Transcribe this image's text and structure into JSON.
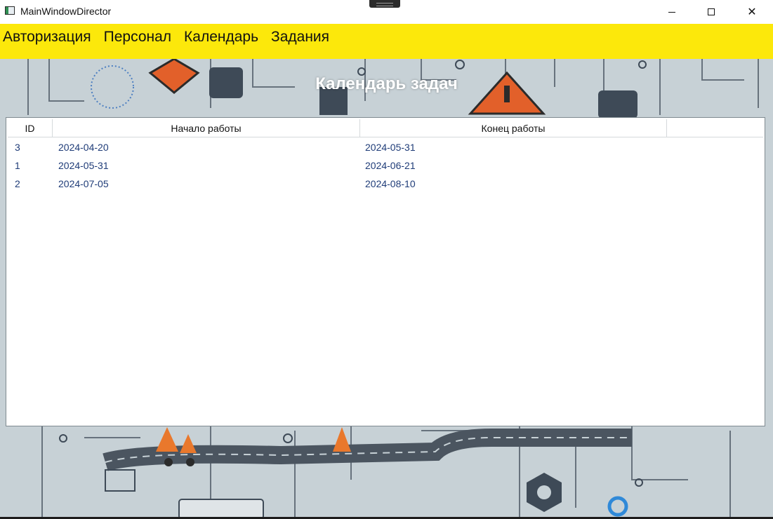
{
  "window": {
    "title": "MainWindowDirector",
    "minimize_label": "Minimize",
    "maximize_label": "Maximize",
    "close_label": "Close",
    "close_glyph": "✕"
  },
  "menu": {
    "items": [
      {
        "label": "Авторизация"
      },
      {
        "label": "Персонал"
      },
      {
        "label": "Календарь"
      },
      {
        "label": "Задания"
      }
    ]
  },
  "page": {
    "heading": "Календарь задач"
  },
  "grid": {
    "columns": [
      "ID",
      "Начало работы",
      "Конец работы"
    ],
    "rows": [
      {
        "id": "3",
        "start": "2024-04-20",
        "end": "2024-05-31"
      },
      {
        "id": "1",
        "start": "2024-05-31",
        "end": "2024-06-21"
      },
      {
        "id": "2",
        "start": "2024-07-05",
        "end": "2024-08-10"
      }
    ]
  },
  "colors": {
    "menubar": "#fce80b",
    "cell_text": "#1f3c78",
    "heading": "#ffffff"
  }
}
